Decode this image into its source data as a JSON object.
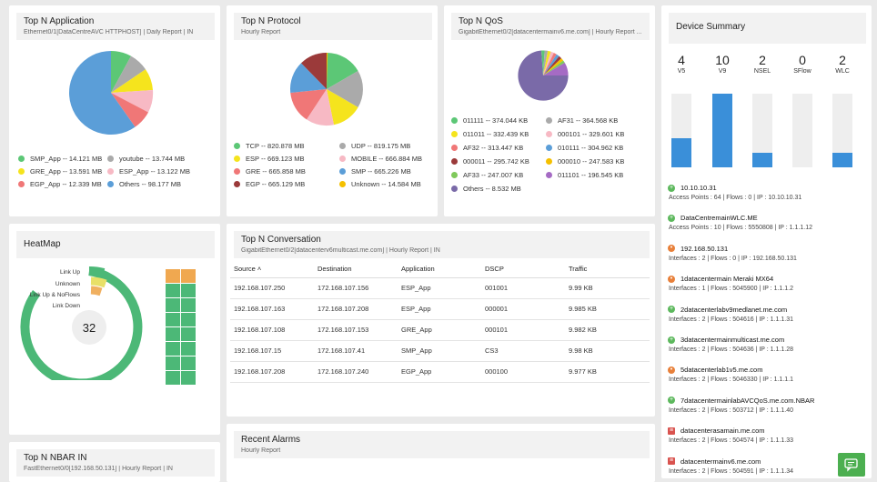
{
  "app_top": {
    "title": "Top N Application",
    "subtitle": "Ethernet0/1[DataCentreAVC HTTPHOST] | Daily Report | IN",
    "legend": [
      [
        "SMP_App -- 14.121 MB",
        "#5cc776"
      ],
      [
        "youtube -- 13.744 MB",
        "#aaaaaa"
      ],
      [
        "GRE_App -- 13.591 MB",
        "#f5e41d"
      ],
      [
        "ESP_App -- 13.122 MB",
        "#f7b9c4"
      ],
      [
        "EGP_App -- 12.339 MB",
        "#f07777"
      ],
      [
        "Others -- 98.177 MB",
        "#5b9ed8"
      ]
    ]
  },
  "protocol": {
    "title": "Top N Protocol",
    "subtitle": "Hourly Report",
    "legend": [
      [
        "TCP -- 820.878 MB",
        "#5cc776"
      ],
      [
        "UDP -- 819.175 MB",
        "#aaaaaa"
      ],
      [
        "ESP -- 669.123 MB",
        "#f5e41d"
      ],
      [
        "MOBILE -- 666.884 MB",
        "#f7b9c4"
      ],
      [
        "GRE -- 665.858 MB",
        "#f07777"
      ],
      [
        "SMP -- 665.226 MB",
        "#5b9ed8"
      ],
      [
        "EGP -- 665.129 MB",
        "#9b3a3a"
      ],
      [
        "Unknown -- 14.584 MB",
        "#f5c000"
      ]
    ]
  },
  "qos": {
    "title": "Top N QoS",
    "subtitle": "GigabitEthernet0/2[datacentermainv6.me.com] | Hourly Report ...",
    "legend": [
      [
        "011111 -- 374.044 KB",
        "#5cc776"
      ],
      [
        "AF31 -- 364.568 KB",
        "#aaaaaa"
      ],
      [
        "011011 -- 332.439 KB",
        "#f5e41d"
      ],
      [
        "000101 -- 329.601 KB",
        "#f7b9c4"
      ],
      [
        "AF32 -- 313.447 KB",
        "#f07777"
      ],
      [
        "010111 -- 304.962 KB",
        "#5b9ed8"
      ],
      [
        "000011 -- 295.742 KB",
        "#9b3a3a"
      ],
      [
        "000010 -- 247.583 KB",
        "#f5c000"
      ],
      [
        "AF33 -- 247.007 KB",
        "#7fc95b"
      ],
      [
        "011101 -- 196.545 KB",
        "#a56bc4"
      ],
      [
        "Others -- 8.532 MB",
        "#7a6aa8"
      ]
    ]
  },
  "device": {
    "title": "Device Summary",
    "stats": [
      {
        "value": "4",
        "label": "V5",
        "fill": 0.4
      },
      {
        "value": "10",
        "label": "V9",
        "fill": 1.0
      },
      {
        "value": "2",
        "label": "NSEL",
        "fill": 0.2
      },
      {
        "value": "0",
        "label": "SFlow",
        "fill": 0.0
      },
      {
        "value": "2",
        "label": "WLC",
        "fill": 0.2
      }
    ],
    "items": [
      {
        "name": "10.10.10.31",
        "detail": "Access Points : 64   |   Flows : 0   |   IP : 10.10.10.31",
        "icon": "plus",
        "color": "#5cb85c"
      },
      {
        "name": "DataCentremainWLC.ME",
        "detail": "Access Points : 10   |   Flows : 5550808   |   IP : 1.1.1.12",
        "icon": "plus",
        "color": "#5cb85c"
      },
      {
        "name": "192.168.50.131",
        "detail": "Interfaces : 2   |   Flows : 0   |   IP : 192.168.50.131",
        "icon": "router",
        "color": "#e8803a"
      },
      {
        "name": "1datacentermain Meraki MX64",
        "detail": "Interfaces : 1   |   Flows : 5045900   |   IP : 1.1.1.2",
        "icon": "router",
        "color": "#e8803a"
      },
      {
        "name": "2datacenterlabv9medlanet.me.com",
        "detail": "Interfaces : 2   |   Flows : 504616   |   IP : 1.1.1.31",
        "icon": "plus",
        "color": "#5cb85c"
      },
      {
        "name": "3datacentermainmulticast.me.com",
        "detail": "Interfaces : 2   |   Flows : 504636   |   IP : 1.1.1.28",
        "icon": "plus",
        "color": "#5cb85c"
      },
      {
        "name": "5datacenterlab1v5.me.com",
        "detail": "Interfaces : 2   |   Flows : 5046330   |   IP : 1.1.1.1",
        "icon": "router",
        "color": "#e8803a"
      },
      {
        "name": "7datacentermainlabAVCQoS.me.com.NBAR",
        "detail": "Interfaces : 2   |   Flows : 503712   |   IP : 1.1.1.40",
        "icon": "plus",
        "color": "#5cb85c"
      },
      {
        "name": "datacenterasamain.me.com",
        "detail": "Interfaces : 2   |   Flows : 504574   |   IP : 1.1.1.33",
        "icon": "firewall",
        "color": "#d9534f"
      },
      {
        "name": "datacentermainv6.me.com",
        "detail": "Interfaces : 2   |   Flows : 504591   |   IP : 1.1.1.34",
        "icon": "firewall",
        "color": "#d9534f"
      }
    ]
  },
  "heatmap": {
    "title": "HeatMap",
    "center": "32",
    "labels": [
      "Link Up",
      "Unknown",
      "Link Up & NoFlows",
      "Link Down"
    ]
  },
  "conversation": {
    "title": "Top N Conversation",
    "subtitle": "GigabitEthernet0/2[datacenterv6multicast.me.com] | Hourly Report | IN",
    "columns": [
      "Source",
      "Destination",
      "Application",
      "DSCP",
      "Traffic"
    ],
    "sort_indicator": "˄",
    "rows": [
      [
        "192.168.107.250",
        "172.168.107.156",
        "ESP_App",
        "001001",
        "9.99 KB"
      ],
      [
        "192.168.107.163",
        "172.168.107.208",
        "ESP_App",
        "000001",
        "9.985 KB"
      ],
      [
        "192.168.107.108",
        "172.168.107.153",
        "GRE_App",
        "000101",
        "9.982 KB"
      ],
      [
        "192.168.107.15",
        "172.168.107.41",
        "SMP_App",
        "CS3",
        "9.98 KB"
      ],
      [
        "192.168.107.208",
        "172.168.107.240",
        "EGP_App",
        "000100",
        "9.977 KB"
      ]
    ]
  },
  "alarms": {
    "title": "Recent Alarms",
    "subtitle": "Hourly Report"
  },
  "nbar": {
    "title": "Top N NBAR IN",
    "subtitle": "FastEthernet0/0[192.168.50.131] | Hourly Report | IN"
  }
}
